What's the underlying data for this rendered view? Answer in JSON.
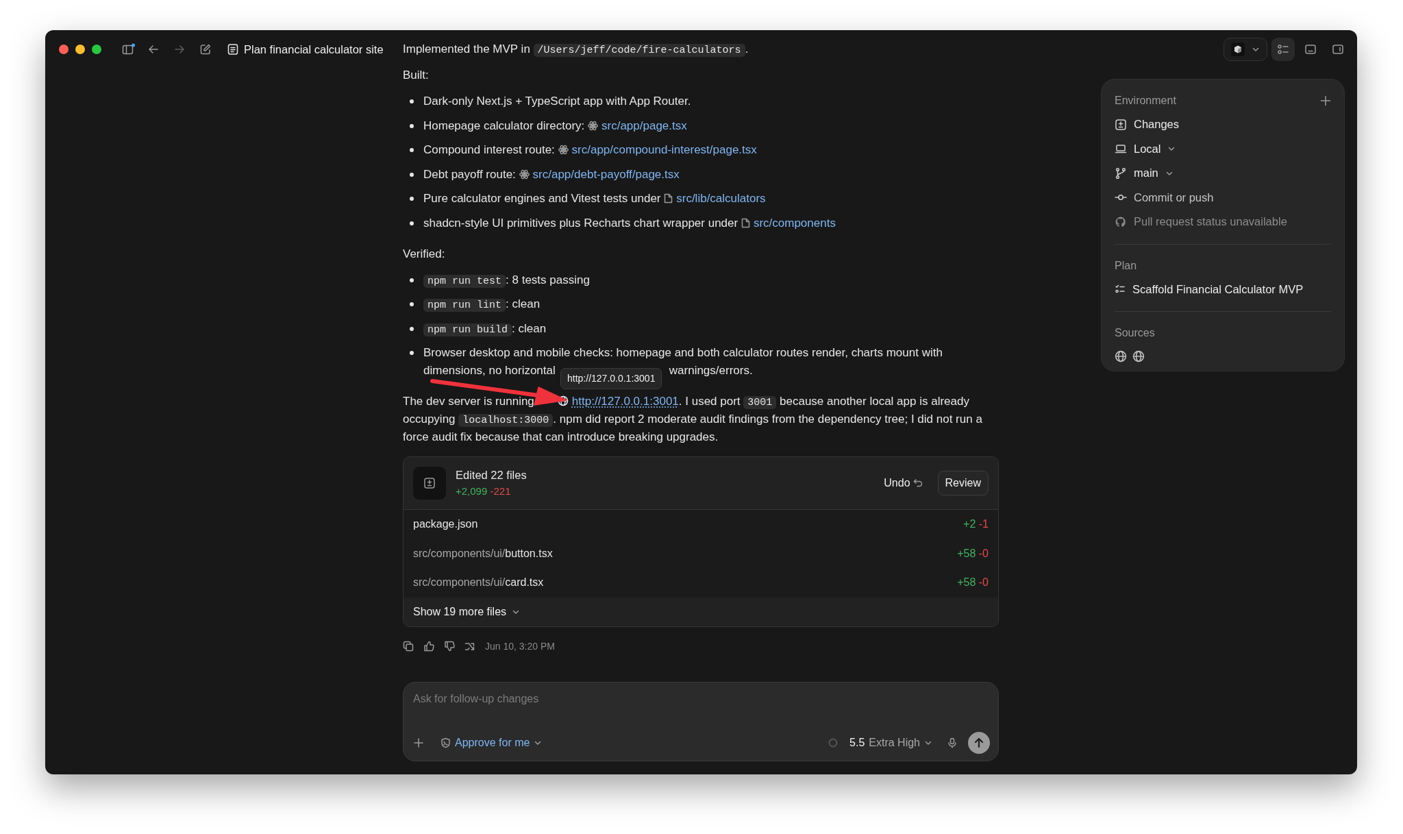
{
  "window": {
    "title": "Plan financial calculator site"
  },
  "view_buttons": [
    {
      "selected": true
    },
    {
      "selected": false
    },
    {
      "selected": false
    }
  ],
  "message": {
    "blocks": [
      {
        "kind": "paragraph",
        "segments": [
          {
            "kind": "text",
            "text": "Implemented the MVP in "
          },
          {
            "kind": "code",
            "text": "/Users/jeff/code/fire-calculators"
          },
          {
            "kind": "text",
            "text": "."
          }
        ]
      },
      {
        "kind": "paragraph",
        "segments": [
          {
            "kind": "text",
            "text": "Built:"
          }
        ]
      },
      {
        "kind": "list",
        "items": [
          [
            {
              "kind": "text",
              "text": "Dark-only Next.js + TypeScript app with App Router."
            }
          ],
          [
            {
              "kind": "text",
              "text": "Homepage calculator directory: "
            },
            {
              "kind": "route",
              "text": "src/app/page.tsx"
            }
          ],
          [
            {
              "kind": "text",
              "text": "Compound interest route: "
            },
            {
              "kind": "route",
              "text": "src/app/compound-interest/page.tsx"
            }
          ],
          [
            {
              "kind": "text",
              "text": "Debt payoff route: "
            },
            {
              "kind": "route",
              "text": "src/app/debt-payoff/page.tsx"
            }
          ],
          [
            {
              "kind": "text",
              "text": "Pure calculator engines and Vitest tests under "
            },
            {
              "kind": "directory",
              "text": "src/lib/calculators"
            }
          ],
          [
            {
              "kind": "text",
              "text": "shadcn-style UI primitives plus Recharts chart wrapper under "
            },
            {
              "kind": "directory",
              "text": "src/components"
            }
          ]
        ]
      },
      {
        "kind": "paragraph",
        "segments": [
          {
            "kind": "text",
            "text": "Verified:"
          }
        ]
      },
      {
        "kind": "list",
        "items": [
          [
            {
              "kind": "code",
              "text": "npm run test"
            },
            {
              "kind": "text",
              "text": ": 8 tests passing"
            }
          ],
          [
            {
              "kind": "code",
              "text": "npm run lint"
            },
            {
              "kind": "text",
              "text": ": clean"
            }
          ],
          [
            {
              "kind": "code",
              "text": "npm run build"
            },
            {
              "kind": "text",
              "text": ": clean"
            }
          ],
          [
            {
              "kind": "text",
              "text": "Browser desktop and mobile checks: homepage and both calculator routes render, charts mount with"
            },
            {
              "kind": "break"
            },
            {
              "kind": "text",
              "text": "dimensions, no horizontal"
            },
            {
              "kind": "covered"
            },
            {
              "kind": "text",
              "text": "warnings/errors."
            }
          ]
        ]
      },
      {
        "kind": "callout",
        "tooltip": "http://127.0.0.1:3001",
        "segments": [
          {
            "kind": "text",
            "text": "The dev server is running"
          },
          {
            "kind": "covered"
          },
          {
            "kind": "url",
            "text": "http://127.0.0.1:3001"
          },
          {
            "kind": "text",
            "text": ". I used port "
          },
          {
            "kind": "code",
            "text": "3001"
          },
          {
            "kind": "text",
            "text": " because another local app is already occupying "
          },
          {
            "kind": "code",
            "text": "localhost:3000"
          },
          {
            "kind": "text",
            "text": ". npm did report 2 moderate audit findings from the dependency tree; I did not run a force audit fix because that can introduce breaking upgrades."
          }
        ]
      }
    ]
  },
  "changes": {
    "title": "Edited 22 files",
    "added": "+2,099",
    "removed": "-221",
    "undo": "Undo",
    "review": "Review",
    "files": [
      {
        "name": "package.json",
        "added": "+2",
        "removed": "-1"
      },
      {
        "dir": "src/components/ui/",
        "name": "button.tsx",
        "added": "+58",
        "removed": "-0"
      },
      {
        "dir": "src/components/ui/",
        "name": "card.tsx",
        "added": "+58",
        "removed": "-0"
      }
    ],
    "more": "Show 19 more files"
  },
  "message_footer": {
    "timestamp": "Jun 10, 3:20 PM"
  },
  "composer": {
    "placeholder": "Ask for follow-up changes",
    "approval": "Approve for me",
    "model": "5.5",
    "effort": "Extra High"
  },
  "sidebar": {
    "sections": [
      {
        "title": "Environment",
        "items": [
          {
            "label": "Changes",
            "dropdown": false,
            "disabled": false
          },
          {
            "label": "Local",
            "dropdown": true,
            "disabled": false
          },
          {
            "label": "main",
            "dropdown": true,
            "disabled": false
          },
          {
            "label": "Commit or push",
            "dropdown": false,
            "disabled": false
          },
          {
            "label": "Pull request status unavailable",
            "dropdown": false,
            "disabled": true
          }
        ]
      },
      {
        "title": "Plan",
        "items": [
          {
            "label": "Scaffold Financial Calculator MVP",
            "dropdown": false,
            "disabled": false
          }
        ]
      },
      {
        "title": "Sources",
        "sources": [
          {
            "kind": "web"
          },
          {
            "kind": "web"
          }
        ]
      }
    ]
  }
}
